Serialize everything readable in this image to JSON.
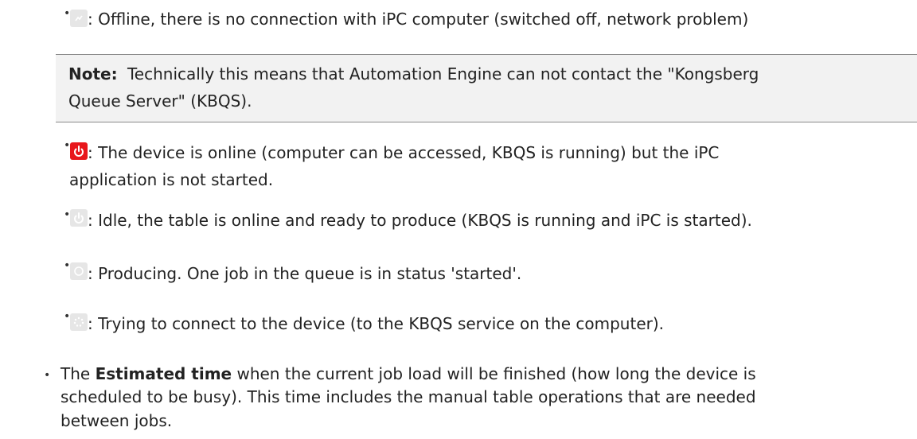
{
  "items": {
    "offline": {
      "icon": "offline-icon",
      "text": ": Offline, there is no connection with iPC computer (switched off, network problem)"
    },
    "note": {
      "label": "Note:",
      "line1": "Technically this means that Automation Engine can not contact the \"Kongsberg",
      "line2": "Queue Server\" (KBQS)."
    },
    "online_not_started": {
      "icon": "power-icon-red",
      "line1": ": The device is online (computer can be accessed, KBQS is running) but the iPC",
      "line2": "application is not started."
    },
    "idle": {
      "icon": "power-icon-grey",
      "text": ": Idle, the table is online and ready to produce (KBQS is running and iPC is started)."
    },
    "producing": {
      "icon": "producing-icon",
      "text": ": Producing. One job in the queue is in status 'started'."
    },
    "connecting": {
      "icon": "connecting-icon",
      "text": ": Trying to connect to the device (to the KBQS service on the computer)."
    }
  },
  "estimated": {
    "prefix": "The ",
    "bold": "Estimated time",
    "line1_rest": " when the current job load will be finished (how long the device is",
    "line2": "scheduled to be busy). This time includes the manual table operations that are needed",
    "line3": "between jobs."
  },
  "colors": {
    "red_icon": "#e8161b",
    "grey_icon": "#e6e6e6",
    "note_bg": "#f2f2f2"
  }
}
